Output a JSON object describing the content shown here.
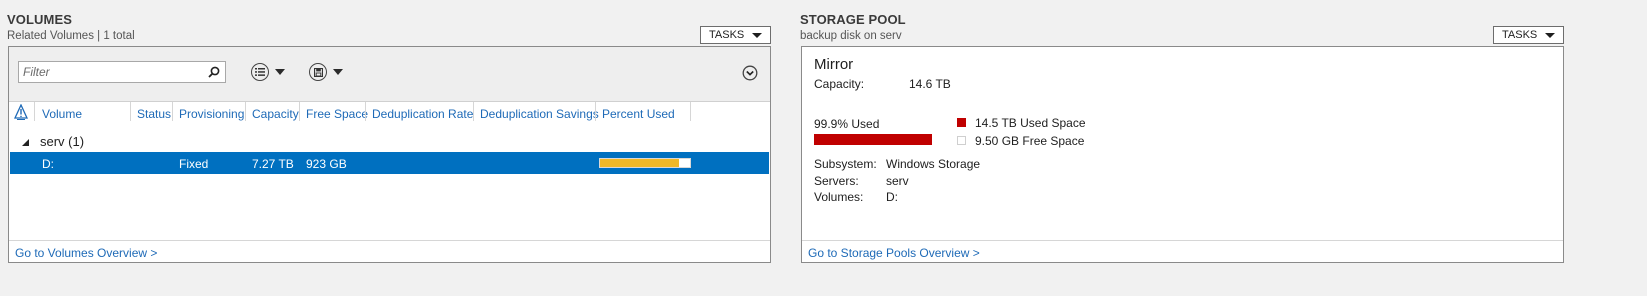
{
  "volumes": {
    "title": "VOLUMES",
    "subtitle": "Related Volumes | 1 total",
    "tasks_label": "TASKS",
    "filter_placeholder": "Filter",
    "columns": [
      "Volume",
      "Status",
      "Provisioning",
      "Capacity",
      "Free Space",
      "Deduplication Rate",
      "Deduplication Savings",
      "Percent Used"
    ],
    "group_label": "serv (1)",
    "rows": [
      {
        "volume": "D:",
        "status": "",
        "provisioning": "Fixed",
        "capacity": "7.27 TB",
        "free_space": "923 GB",
        "dedup_rate": "",
        "dedup_savings": "",
        "percent_used_fraction": 0.88
      }
    ],
    "footer_link": "Go to Volumes Overview >"
  },
  "storage_pool": {
    "title": "STORAGE POOL",
    "subtitle": "backup disk on serv",
    "tasks_label": "TASKS",
    "name": "Mirror",
    "capacity_label": "Capacity:",
    "capacity_value": "14.6 TB",
    "used_text": "99.9% Used",
    "used_fraction": 0.999,
    "legend_used": "14.5 TB Used Space",
    "legend_free": "9.50 GB Free Space",
    "details": [
      {
        "label": "Subsystem:",
        "value": "Windows Storage"
      },
      {
        "label": "Servers:",
        "value": "serv"
      },
      {
        "label": "Volumes:",
        "value": "D:"
      }
    ],
    "footer_link": "Go to Storage Pools Overview >"
  },
  "colors": {
    "selection": "#0070c0",
    "link": "#1e6ab7",
    "usage_bar_yellow": "#f0b828",
    "pool_used_red": "#c00000"
  },
  "icons": {
    "search": "search-icon",
    "list_view": "list-view-icon",
    "save_query": "save-query-icon",
    "expand": "chevron-down-circle-icon",
    "sort_warning": "sort-warning-icon",
    "group_collapse": "collapse-triangle-icon"
  }
}
